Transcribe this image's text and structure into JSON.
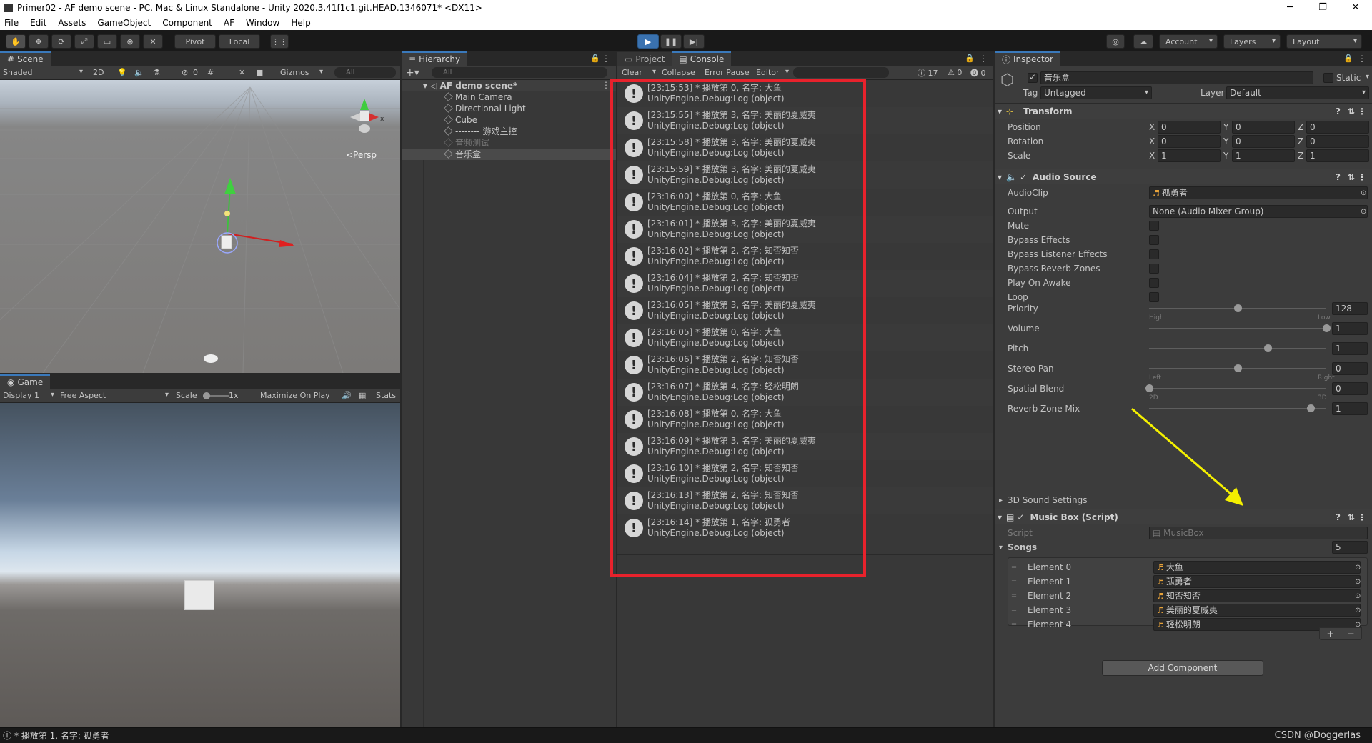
{
  "window": {
    "title": "Primer02 - AF demo scene - PC, Mac & Linux Standalone - Unity 2020.3.41f1c1.git.HEAD.1346071* <DX11>",
    "controls": [
      "─",
      "❐",
      "✕"
    ]
  },
  "menu": [
    "File",
    "Edit",
    "Assets",
    "GameObject",
    "Component",
    "AF",
    "Window",
    "Help"
  ],
  "toolbar": {
    "pivot": "Pivot",
    "local": "Local",
    "account": "Account",
    "layers": "Layers",
    "layout": "Layout"
  },
  "scene": {
    "tab": "Scene",
    "shading": "Shaded",
    "mode_2d": "2D",
    "hidden_count": "0",
    "gizmos": "Gizmos",
    "search_placeholder": "All",
    "persp": "<Persp"
  },
  "game": {
    "tab": "Game",
    "display": "Display 1",
    "aspect": "Free Aspect",
    "scale_label": "Scale",
    "scale_value": "1x",
    "maximize": "Maximize On Play",
    "stats": "Stats"
  },
  "hierarchy": {
    "tab": "Hierarchy",
    "search_placeholder": "All",
    "scene_name": "AF demo scene*",
    "items": [
      "Main Camera",
      "Directional Light",
      "Cube",
      "-------- 游戏主控",
      "音频测试",
      "音乐盒"
    ]
  },
  "console": {
    "tabs": [
      "Project",
      "Console"
    ],
    "buttons": [
      "Clear",
      "Collapse",
      "Error Pause",
      "Editor"
    ],
    "counts": {
      "log": "17",
      "warn": "0",
      "error": "0"
    },
    "entries": [
      {
        "line1": "[23:15:53] * 播放第 0, 名字: 大鱼",
        "line2": "UnityEngine.Debug:Log (object)"
      },
      {
        "line1": "[23:15:55] * 播放第 3, 名字: 美丽的夏威夷",
        "line2": "UnityEngine.Debug:Log (object)"
      },
      {
        "line1": "[23:15:58] * 播放第 3, 名字: 美丽的夏威夷",
        "line2": "UnityEngine.Debug:Log (object)"
      },
      {
        "line1": "[23:15:59] * 播放第 3, 名字: 美丽的夏威夷",
        "line2": "UnityEngine.Debug:Log (object)"
      },
      {
        "line1": "[23:16:00] * 播放第 0, 名字: 大鱼",
        "line2": "UnityEngine.Debug:Log (object)"
      },
      {
        "line1": "[23:16:01] * 播放第 3, 名字: 美丽的夏威夷",
        "line2": "UnityEngine.Debug:Log (object)"
      },
      {
        "line1": "[23:16:02] * 播放第 2, 名字: 知否知否",
        "line2": "UnityEngine.Debug:Log (object)"
      },
      {
        "line1": "[23:16:04] * 播放第 2, 名字: 知否知否",
        "line2": "UnityEngine.Debug:Log (object)"
      },
      {
        "line1": "[23:16:05] * 播放第 3, 名字: 美丽的夏威夷",
        "line2": "UnityEngine.Debug:Log (object)"
      },
      {
        "line1": "[23:16:05] * 播放第 0, 名字: 大鱼",
        "line2": "UnityEngine.Debug:Log (object)"
      },
      {
        "line1": "[23:16:06] * 播放第 2, 名字: 知否知否",
        "line2": "UnityEngine.Debug:Log (object)"
      },
      {
        "line1": "[23:16:07] * 播放第 4, 名字: 轻松明朗",
        "line2": "UnityEngine.Debug:Log (object)"
      },
      {
        "line1": "[23:16:08] * 播放第 0, 名字: 大鱼",
        "line2": "UnityEngine.Debug:Log (object)"
      },
      {
        "line1": "[23:16:09] * 播放第 3, 名字: 美丽的夏威夷",
        "line2": "UnityEngine.Debug:Log (object)"
      },
      {
        "line1": "[23:16:10] * 播放第 2, 名字: 知否知否",
        "line2": "UnityEngine.Debug:Log (object)"
      },
      {
        "line1": "[23:16:13] * 播放第 2, 名字: 知否知否",
        "line2": "UnityEngine.Debug:Log (object)"
      },
      {
        "line1": "[23:16:14] * 播放第 1, 名字: 孤勇者",
        "line2": "UnityEngine.Debug:Log (object)"
      }
    ]
  },
  "inspector": {
    "tab": "Inspector",
    "object_name": "音乐盒",
    "static": "Static",
    "tag_label": "Tag",
    "tag": "Untagged",
    "layer_label": "Layer",
    "layer": "Default",
    "transform": {
      "title": "Transform",
      "rows": [
        {
          "label": "Position",
          "x": "0",
          "y": "0",
          "z": "0"
        },
        {
          "label": "Rotation",
          "x": "0",
          "y": "0",
          "z": "0"
        },
        {
          "label": "Scale",
          "x": "1",
          "y": "1",
          "z": "1"
        }
      ]
    },
    "audio_source": {
      "title": "Audio Source",
      "audioclip_label": "AudioClip",
      "audioclip": "孤勇者",
      "output_label": "Output",
      "output": "None (Audio Mixer Group)",
      "toggles": [
        "Mute",
        "Bypass Effects",
        "Bypass Listener Effects",
        "Bypass Reverb Zones",
        "Play On Awake",
        "Loop"
      ],
      "sliders": [
        {
          "label": "Priority",
          "value": "128",
          "fraction": 0.5,
          "min_label": "High",
          "max_label": "Low"
        },
        {
          "label": "Volume",
          "value": "1",
          "fraction": 1.0,
          "min_label": "",
          "max_label": ""
        },
        {
          "label": "Pitch",
          "value": "1",
          "fraction": 0.67,
          "min_label": "",
          "max_label": ""
        },
        {
          "label": "Stereo Pan",
          "value": "0",
          "fraction": 0.5,
          "min_label": "Left",
          "max_label": "Right"
        },
        {
          "label": "Spatial Blend",
          "value": "0",
          "fraction": 0.0,
          "min_label": "2D",
          "max_label": "3D"
        },
        {
          "label": "Reverb Zone Mix",
          "value": "1",
          "fraction": 0.91,
          "min_label": "",
          "max_label": ""
        }
      ],
      "sound_settings": "3D Sound Settings"
    },
    "music_box": {
      "title": "Music Box (Script)",
      "script_label": "Script",
      "script": "MusicBox",
      "songs_label": "Songs",
      "songs_count": "5",
      "elements": [
        {
          "label": "Element 0",
          "value": "大鱼"
        },
        {
          "label": "Element 1",
          "value": "孤勇者"
        },
        {
          "label": "Element 2",
          "value": "知否知否"
        },
        {
          "label": "Element 3",
          "value": "美丽的夏威夷"
        },
        {
          "label": "Element 4",
          "value": "轻松明朗"
        }
      ]
    },
    "add_component": "Add Component"
  },
  "status": {
    "message": "* 播放第 1, 名字: 孤勇者",
    "watermark": "CSDN @Doggerlas"
  },
  "colors": {
    "highlight_box": "#e8222c",
    "arrow": "#f4f000",
    "accent": "#3a79bb"
  }
}
